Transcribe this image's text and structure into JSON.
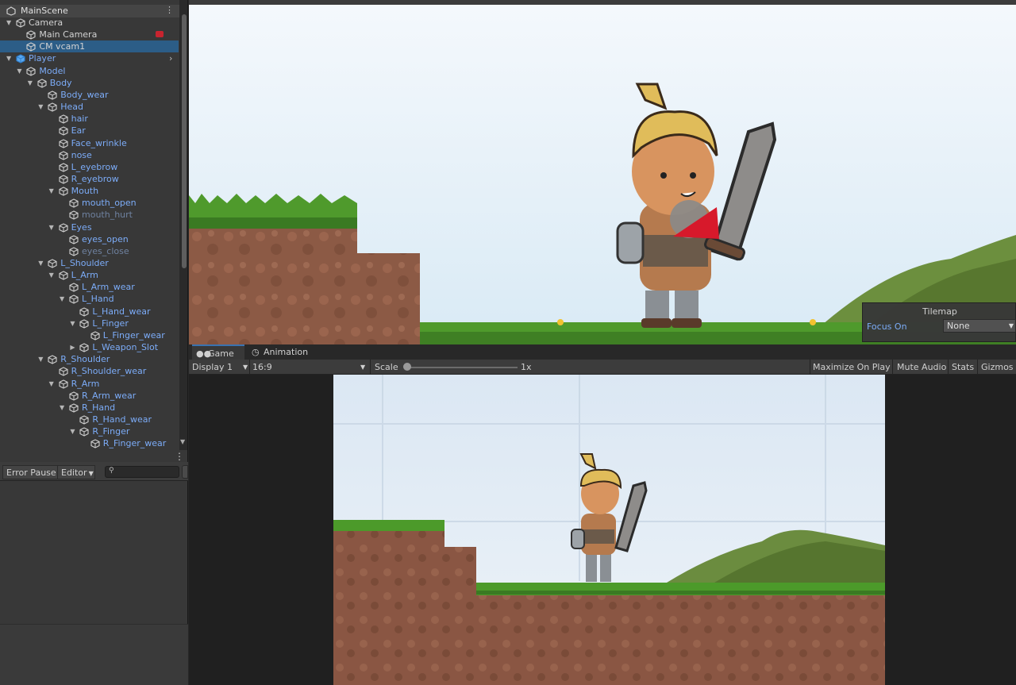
{
  "hierarchy": {
    "scene_name": "MainScene",
    "items": [
      {
        "label": "Camera",
        "depth": 1,
        "color": "white",
        "arrow": "down",
        "icon": "gameobject-icon"
      },
      {
        "label": "Main Camera",
        "depth": 2,
        "color": "white",
        "arrow": "",
        "icon": "gameobject-icon",
        "badge": "camera-icon"
      },
      {
        "label": "CM vcam1",
        "depth": 2,
        "color": "white",
        "arrow": "",
        "icon": "gameobject-icon",
        "selected": true
      },
      {
        "label": "Player",
        "depth": 1,
        "color": "blue",
        "arrow": "down",
        "icon": "prefab-icon",
        "more": true
      },
      {
        "label": "Model",
        "depth": 2,
        "color": "blue",
        "arrow": "down",
        "icon": "gameobject-icon"
      },
      {
        "label": "Body",
        "depth": 3,
        "color": "blue",
        "arrow": "down",
        "icon": "gameobject-icon"
      },
      {
        "label": "Body_wear",
        "depth": 4,
        "color": "blue",
        "arrow": "",
        "icon": "gameobject-icon"
      },
      {
        "label": "Head",
        "depth": 4,
        "color": "blue",
        "arrow": "down",
        "icon": "gameobject-icon"
      },
      {
        "label": "hair",
        "depth": 5,
        "color": "blue",
        "arrow": "",
        "icon": "gameobject-icon"
      },
      {
        "label": "Ear",
        "depth": 5,
        "color": "blue",
        "arrow": "",
        "icon": "gameobject-icon"
      },
      {
        "label": "Face_wrinkle",
        "depth": 5,
        "color": "blue",
        "arrow": "",
        "icon": "gameobject-icon"
      },
      {
        "label": "nose",
        "depth": 5,
        "color": "blue",
        "arrow": "",
        "icon": "gameobject-icon"
      },
      {
        "label": "L_eyebrow",
        "depth": 5,
        "color": "blue",
        "arrow": "",
        "icon": "gameobject-icon"
      },
      {
        "label": "R_eyebrow",
        "depth": 5,
        "color": "blue",
        "arrow": "",
        "icon": "gameobject-icon"
      },
      {
        "label": "Mouth",
        "depth": 5,
        "color": "blue",
        "arrow": "down",
        "icon": "gameobject-icon"
      },
      {
        "label": "mouth_open",
        "depth": 6,
        "color": "blue",
        "arrow": "",
        "icon": "gameobject-icon"
      },
      {
        "label": "mouth_hurt",
        "depth": 6,
        "color": "dim",
        "arrow": "",
        "icon": "gameobject-icon"
      },
      {
        "label": "Eyes",
        "depth": 5,
        "color": "blue",
        "arrow": "down",
        "icon": "gameobject-icon"
      },
      {
        "label": "eyes_open",
        "depth": 6,
        "color": "blue",
        "arrow": "",
        "icon": "gameobject-icon"
      },
      {
        "label": "eyes_close",
        "depth": 6,
        "color": "dim",
        "arrow": "",
        "icon": "gameobject-icon"
      },
      {
        "label": "L_Shoulder",
        "depth": 4,
        "color": "blue",
        "arrow": "down",
        "icon": "gameobject-icon"
      },
      {
        "label": "L_Arm",
        "depth": 5,
        "color": "blue",
        "arrow": "down",
        "icon": "gameobject-icon"
      },
      {
        "label": "L_Arm_wear",
        "depth": 6,
        "color": "blue",
        "arrow": "",
        "icon": "gameobject-icon"
      },
      {
        "label": "L_Hand",
        "depth": 6,
        "color": "blue",
        "arrow": "down",
        "icon": "gameobject-icon"
      },
      {
        "label": "L_Hand_wear",
        "depth": 7,
        "color": "blue",
        "arrow": "",
        "icon": "gameobject-icon"
      },
      {
        "label": "L_Finger",
        "depth": 7,
        "color": "blue",
        "arrow": "down",
        "icon": "gameobject-icon"
      },
      {
        "label": "L_Finger_wear",
        "depth": 8,
        "color": "blue",
        "arrow": "",
        "icon": "gameobject-icon"
      },
      {
        "label": "L_Weapon_Slot",
        "depth": 7,
        "color": "blue",
        "arrow": "right",
        "icon": "gameobject-icon"
      },
      {
        "label": "R_Shoulder",
        "depth": 4,
        "color": "blue",
        "arrow": "down",
        "icon": "gameobject-icon"
      },
      {
        "label": "R_Shoulder_wear",
        "depth": 5,
        "color": "blue",
        "arrow": "",
        "icon": "gameobject-icon"
      },
      {
        "label": "R_Arm",
        "depth": 5,
        "color": "blue",
        "arrow": "down",
        "icon": "gameobject-icon"
      },
      {
        "label": "R_Arm_wear",
        "depth": 6,
        "color": "blue",
        "arrow": "",
        "icon": "gameobject-icon"
      },
      {
        "label": "R_Hand",
        "depth": 6,
        "color": "blue",
        "arrow": "down",
        "icon": "gameobject-icon"
      },
      {
        "label": "R_Hand_wear",
        "depth": 7,
        "color": "blue",
        "arrow": "",
        "icon": "gameobject-icon"
      },
      {
        "label": "R_Finger",
        "depth": 7,
        "color": "blue",
        "arrow": "down",
        "icon": "gameobject-icon"
      },
      {
        "label": "R_Finger_wear",
        "depth": 8,
        "color": "blue",
        "arrow": "",
        "icon": "gameobject-icon"
      }
    ]
  },
  "console": {
    "error_pause_label": "Error Pause",
    "editor_label": "Editor"
  },
  "tilemap": {
    "title": "Tilemap",
    "focus_label": "Focus On",
    "focus_value": "None"
  },
  "game_tabs": {
    "game_label": "Game",
    "animation_label": "Animation"
  },
  "game_toolbar": {
    "display": "Display 1",
    "aspect": "16:9",
    "scale_label": "Scale",
    "scale_value": "1x",
    "maximize": "Maximize On Play",
    "mute": "Mute Audio",
    "stats": "Stats",
    "gizmos": "Gizmos"
  },
  "colors": {
    "selection": "#2c5d87",
    "prefab_blue": "#7cacf8",
    "sky": "#e8f2fa",
    "grass": "#4c9a2a",
    "dirt": "#8c5a45"
  }
}
